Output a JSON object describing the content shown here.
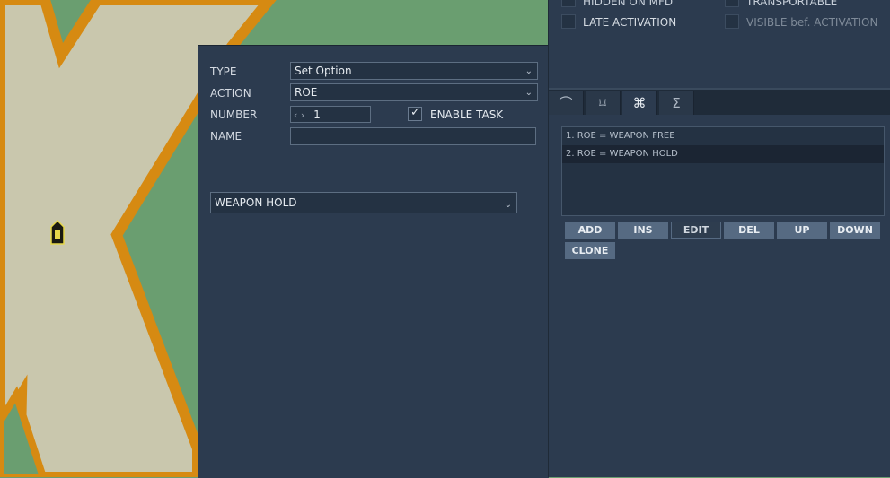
{
  "task": {
    "type_label": "TYPE",
    "type_value": "Set Option",
    "action_label": "ACTION",
    "action_value": "ROE",
    "number_label": "NUMBER",
    "number_value": "1",
    "enable_task_label": "ENABLE TASK",
    "enable_task_checked": true,
    "name_label": "NAME",
    "name_value": "",
    "option_value": "WEAPON HOLD"
  },
  "unit_flags": {
    "hidden_on_mfd": "HIDDEN ON MFD",
    "transportable": "TRANSPORTABLE",
    "late_activation": "LATE ACTIVATION",
    "visible_before_activation": "VISIBLE bef. ACTIVATION"
  },
  "tabs": [
    {
      "icon": "route-icon",
      "glyph": "⌒"
    },
    {
      "icon": "target-icon",
      "glyph": "⌑"
    },
    {
      "icon": "command-icon",
      "glyph": "⌘"
    },
    {
      "icon": "sigma-icon",
      "glyph": "Σ"
    }
  ],
  "task_list": [
    {
      "text": "1. ROE = WEAPON FREE"
    },
    {
      "text": "2. ROE = WEAPON HOLD"
    }
  ],
  "buttons": {
    "add": "ADD",
    "ins": "INS",
    "edit": "EDIT",
    "del": "DEL",
    "up": "UP",
    "down": "DOWN",
    "clone": "CLONE"
  }
}
